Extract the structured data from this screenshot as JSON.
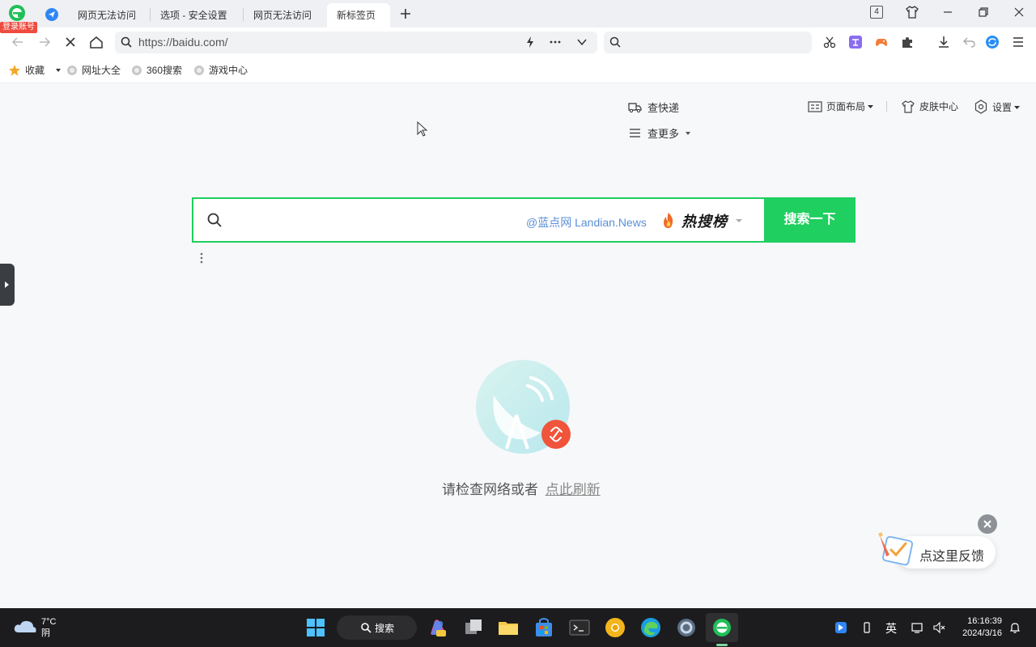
{
  "browser": {
    "login_badge": "登录账号",
    "tabs": [
      {
        "label": "网页无法访问"
      },
      {
        "label": "选项 - 安全设置"
      },
      {
        "label": "网页无法访问"
      },
      {
        "label": "新标签页"
      }
    ],
    "tab_count": "4",
    "url": "https://baidu.com/"
  },
  "bookmarks": {
    "favorites_label": "收藏",
    "items": [
      {
        "label": "网址大全"
      },
      {
        "label": "360搜索"
      },
      {
        "label": "游戏中心"
      }
    ]
  },
  "page": {
    "links": {
      "express": "查快递",
      "more": "查更多",
      "layout": "页面布局",
      "skin": "皮肤中心",
      "settings": "设置"
    },
    "search": {
      "watermark": "@蓝点网 Landian.News",
      "hot_label": "热搜榜",
      "button_label": "搜索一下"
    },
    "error": {
      "message": "请检查网络或者",
      "refresh_link": "点此刷新"
    },
    "feedback_label": "点这里反馈"
  },
  "taskbar": {
    "weather_temp": "7°C",
    "weather_desc": "阴",
    "search_label": "搜索",
    "ime_label": "英",
    "time": "16:16:39",
    "date": "2024/3/16"
  },
  "colors": {
    "brand_green": "#1fcf5f",
    "alert_red": "#f0543a"
  }
}
